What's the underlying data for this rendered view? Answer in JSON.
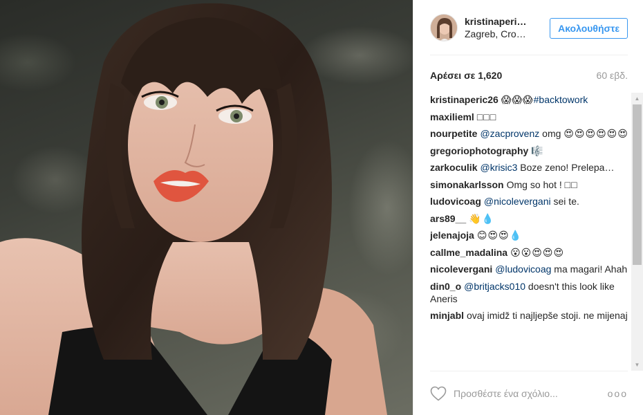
{
  "post": {
    "image_alt": "Selfie of a woman with dark brown fringe haircut and coral lipstick against a textured gray wall",
    "owner": {
      "username": "kristinaperi…",
      "location": "Zagreb, Cro…"
    },
    "follow_label": "Ακολουθήστε",
    "likes_text": "Αρέσει σε 1,620",
    "time_ago": "60 εβδ.",
    "comments": [
      {
        "user": "kristinaperic26",
        "parts": [
          {
            "t": "emoji",
            "v": "😱😱😱"
          },
          {
            "t": "mention",
            "v": "#backtowork"
          }
        ]
      },
      {
        "user": "maxilieml",
        "parts": [
          {
            "t": "emoji",
            "v": "□□□"
          }
        ]
      },
      {
        "user": "nourpetite",
        "parts": [
          {
            "t": "mention",
            "v": "@zacprovenz"
          },
          {
            "t": "text",
            "v": " omg "
          },
          {
            "t": "emoji",
            "v": "😍😍😍😍😍😍"
          }
        ]
      },
      {
        "user": "gregoriophotography",
        "parts": [
          {
            "t": "emoji",
            "v": "🎼"
          }
        ]
      },
      {
        "user": "zarkoculik",
        "parts": [
          {
            "t": "mention",
            "v": "@krisic3"
          },
          {
            "t": "text",
            "v": " Boze zeno! Prelepa…"
          }
        ]
      },
      {
        "user": "simonakarlsson",
        "parts": [
          {
            "t": "text",
            "v": "Omg so hot ! "
          },
          {
            "t": "emoji",
            "v": "□□"
          }
        ]
      },
      {
        "user": "ludovicoag",
        "parts": [
          {
            "t": "mention",
            "v": "@nicolevergani"
          },
          {
            "t": "text",
            "v": " sei te."
          }
        ]
      },
      {
        "user": "ars89__",
        "parts": [
          {
            "t": "emoji",
            "v": "👋💧"
          }
        ]
      },
      {
        "user": "jelenajoja",
        "parts": [
          {
            "t": "emoji",
            "v": "😊😍😍💧"
          }
        ]
      },
      {
        "user": "callme_madalina",
        "parts": [
          {
            "t": "emoji",
            "v": "😮😮😍😍😍"
          }
        ]
      },
      {
        "user": "nicolevergani",
        "parts": [
          {
            "t": "mention",
            "v": "@ludovicoag"
          },
          {
            "t": "text",
            "v": " ma magari! Ahah"
          }
        ]
      },
      {
        "user": "din0_o",
        "parts": [
          {
            "t": "mention",
            "v": "@britjacks010"
          },
          {
            "t": "text",
            "v": " doesn't this look like Aneris"
          }
        ]
      },
      {
        "user": "minjabl",
        "parts": [
          {
            "t": "text",
            "v": "ovaj imidž ti najljepše stoji. ne mijenaj"
          }
        ]
      }
    ],
    "add_comment_placeholder": "Προσθέστε ένα σχόλιο...",
    "more_label": "ooo"
  },
  "colors": {
    "accent": "#3897f0",
    "mention": "#003569",
    "muted": "#999999",
    "text": "#262626"
  },
  "icons": {
    "like": "heart-outline-icon",
    "more": "ellipsis-icon",
    "scroll_up": "triangle-up-icon",
    "scroll_down": "triangle-down-icon"
  }
}
